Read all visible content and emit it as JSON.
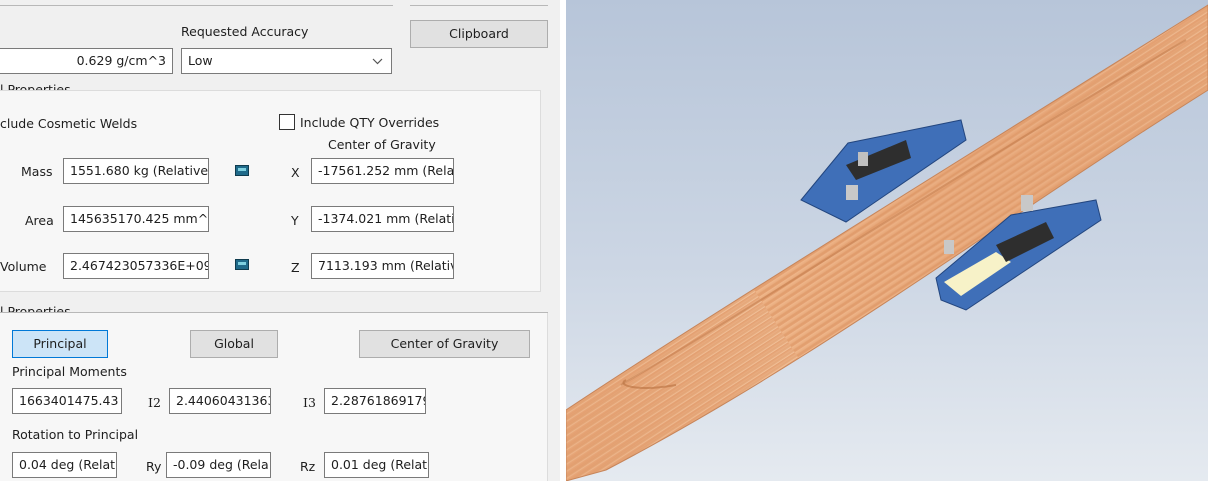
{
  "header": {
    "requested_accuracy_label": "Requested Accuracy",
    "density_value": "0.629 g/cm^3",
    "accuracy_selected": "Low",
    "clipboard_label": "Clipboard"
  },
  "general_properties": {
    "title": "l Properties",
    "include_cosmetic_welds_label": "clude Cosmetic Welds",
    "include_qty_overrides_label": "Include QTY Overrides",
    "center_of_gravity_label": "Center of Gravity",
    "mass_label": "Mass",
    "mass_value": "1551.680 kg (Relative",
    "area_label": "Area",
    "area_value": "145635170.425 mm^:",
    "volume_label": "Volume",
    "volume_value": "2.467423057336E+09",
    "cog_x_label": "X",
    "cog_x_value": "-17561.252 mm (Rela",
    "cog_y_label": "Y",
    "cog_y_value": "-1374.021 mm (Relati",
    "cog_z_label": "Z",
    "cog_z_value": "7113.193 mm (Relativ"
  },
  "inertial_properties": {
    "title": "l Properties",
    "principal_button": "Principal",
    "global_button": "Global",
    "cog_button": "Center of Gravity",
    "principal_moments_label": "Principal Moments",
    "i1_value": "1663401475.43",
    "i2_label": "I2",
    "i2_value": "2.44060431363",
    "i3_label": "I3",
    "i3_value": "2.28761869179",
    "rotation_label": "Rotation to Principal",
    "rx_value": "0.04 deg (Relat",
    "ry_label": "Ry",
    "ry_value": "-0.09 deg (Rela",
    "rz_label": "Rz",
    "rz_value": "0.01 deg (Relat"
  },
  "viewport": {
    "background_top": "#b7c5d9",
    "background_bottom": "#e5eaf0",
    "hull_color": "#e9ab7f",
    "pontoon_color": "#3f6fb8"
  }
}
